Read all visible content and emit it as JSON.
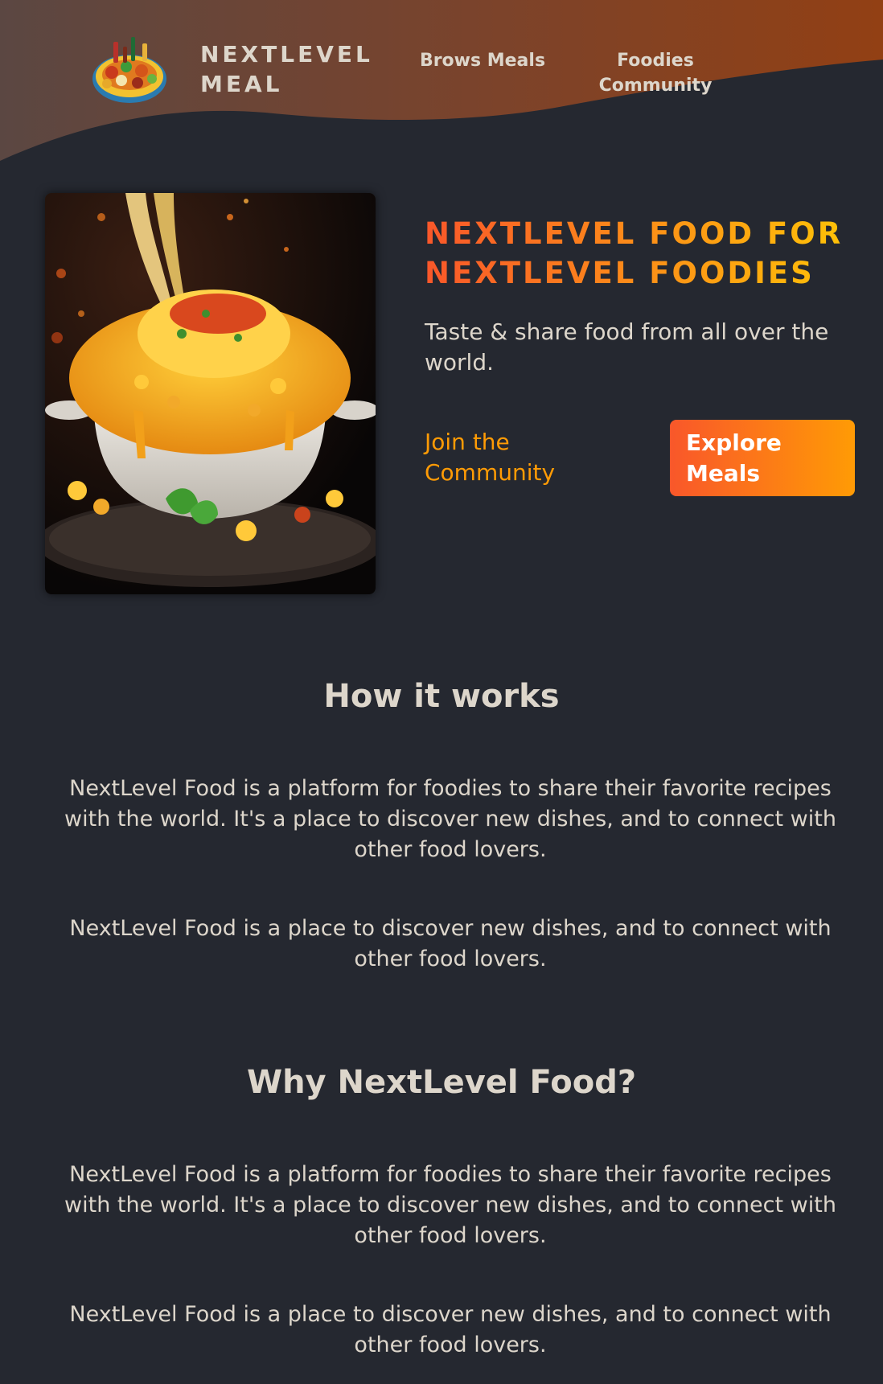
{
  "header": {
    "logo_text": "NEXTLEVEL MEAL",
    "nav": [
      {
        "label": "Brows Meals"
      },
      {
        "label": "Foodies Community"
      }
    ]
  },
  "hero": {
    "title": "NEXTLEVEL FOOD FOR NEXTLEVEL FOODIES",
    "subtitle": "Taste & share food from all over the world.",
    "join_label": "Join the Community",
    "explore_label": "Explore Meals"
  },
  "sections": [
    {
      "title": "How it works",
      "paragraphs": [
        "NextLevel Food is a platform for foodies to share their favorite recipes with the world. It's a place to discover new dishes, and to connect with other food lovers.",
        "NextLevel Food is a place to discover new dishes, and to connect with other food lovers."
      ]
    },
    {
      "title": "Why NextLevel Food?",
      "paragraphs": [
        "NextLevel Food is a platform for foodies to share their favorite recipes with the world. It's a place to discover new dishes, and to connect with other food lovers.",
        "NextLevel Food is a place to discover new dishes, and to connect with other food lovers."
      ]
    }
  ],
  "colors": {
    "background": "#252830",
    "accent_start": "#f9572a",
    "accent_end": "#ff9b05",
    "text": "#ddd6cb"
  },
  "icons": {
    "logo": "food-platter-icon"
  }
}
